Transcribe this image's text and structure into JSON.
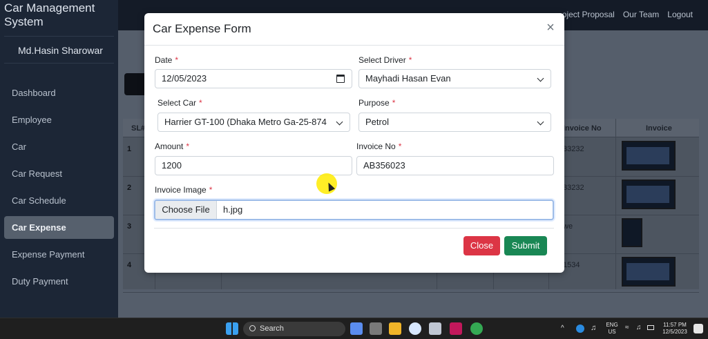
{
  "app": {
    "brand": "Car Management System",
    "user_name": "Md.Hasin Sharowar"
  },
  "topnav": [
    "oject Proposal",
    "Our Team",
    "Logout"
  ],
  "sidebar": {
    "items": [
      {
        "label": "Dashboard"
      },
      {
        "label": "Employee"
      },
      {
        "label": "Car"
      },
      {
        "label": "Car Request"
      },
      {
        "label": "Car Schedule"
      },
      {
        "label": "Car Expense",
        "active": true
      },
      {
        "label": "Expense Payment"
      },
      {
        "label": "Duty Payment"
      }
    ]
  },
  "table": {
    "header_sl": "SL#",
    "header_invoice_no": "Invoice No",
    "header_invoice": "Invoice",
    "rows": [
      {
        "sl": "1",
        "invoice_no": "33232"
      },
      {
        "sl": "2",
        "invoice_no": "33232"
      },
      {
        "sl": "3",
        "invoice_no": "we"
      },
      {
        "sl": "4",
        "invoice_no": "1534"
      }
    ]
  },
  "modal": {
    "title": "Car Expense Form",
    "close_symbol": "×",
    "required_mark": "*",
    "date": {
      "label": "Date",
      "value": "12/05/2023",
      "icon": "calendar-icon"
    },
    "driver": {
      "label": "Select Driver",
      "value": "Mayhadi Hasan Evan"
    },
    "car": {
      "label": "Select Car",
      "value": "Harrier GT-100 (Dhaka Metro Ga-25-874"
    },
    "purpose": {
      "label": "Purpose",
      "value": "Petrol"
    },
    "amount": {
      "label": "Amount",
      "value": "1200"
    },
    "invoice_no": {
      "label": "Invoice No",
      "value": "AB356023"
    },
    "invoice_image": {
      "label": "Invoice Image",
      "button": "Choose File",
      "file": "h.jpg"
    },
    "buttons": {
      "close": "Close",
      "submit": "Submit"
    }
  },
  "taskbar": {
    "search_label": "Search",
    "lang_1": "ENG",
    "lang_2": "US",
    "time": "11:57 PM",
    "date": "12/5/2023"
  },
  "colors": {
    "close_button": "#dc3545",
    "submit_button": "#198754",
    "sidebar_bg": "#1c2636",
    "active_nav": "#56606d"
  }
}
